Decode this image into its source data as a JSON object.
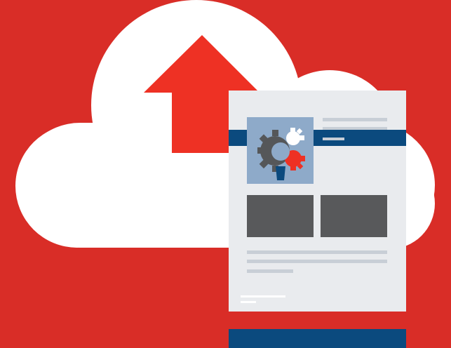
{
  "colors": {
    "background": "#d92d27",
    "cloud": "#ffffff",
    "arrow": "#ee3124",
    "document_paper": "#e9ebee",
    "document_band": "#0b4a7e",
    "image_tile": "#8eaac9",
    "gear_dark": "#555759",
    "gear_white": "#ffffff",
    "gear_red": "#ee3124",
    "placeholder_lines": "#c8ced6",
    "content_blocks": "#58595b"
  },
  "icons": {
    "cloud": "cloud-icon",
    "arrow": "upload-arrow-icon",
    "document": "document-icon",
    "gear": "gear-icon"
  }
}
